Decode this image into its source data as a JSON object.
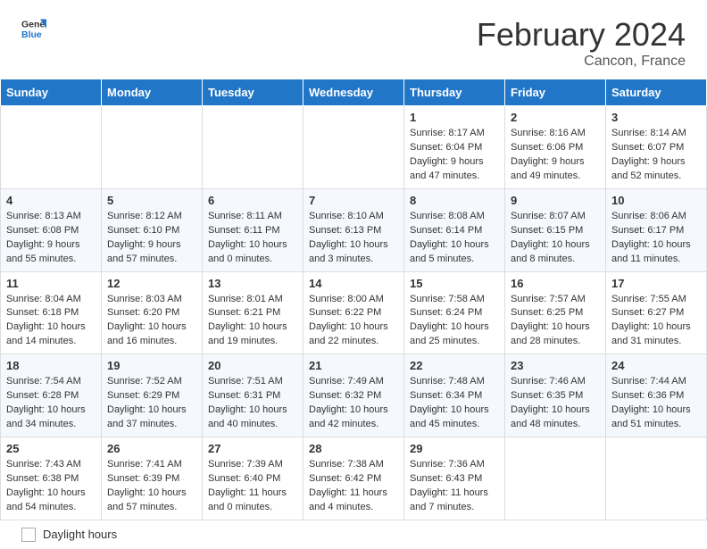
{
  "header": {
    "logo_general": "General",
    "logo_blue": "Blue",
    "month_title": "February 2024",
    "location": "Cancon, France"
  },
  "weekdays": [
    "Sunday",
    "Monday",
    "Tuesday",
    "Wednesday",
    "Thursday",
    "Friday",
    "Saturday"
  ],
  "weeks": [
    [
      {
        "day": "",
        "info": ""
      },
      {
        "day": "",
        "info": ""
      },
      {
        "day": "",
        "info": ""
      },
      {
        "day": "",
        "info": ""
      },
      {
        "day": "1",
        "info": "Sunrise: 8:17 AM\nSunset: 6:04 PM\nDaylight: 9 hours and 47 minutes."
      },
      {
        "day": "2",
        "info": "Sunrise: 8:16 AM\nSunset: 6:06 PM\nDaylight: 9 hours and 49 minutes."
      },
      {
        "day": "3",
        "info": "Sunrise: 8:14 AM\nSunset: 6:07 PM\nDaylight: 9 hours and 52 minutes."
      }
    ],
    [
      {
        "day": "4",
        "info": "Sunrise: 8:13 AM\nSunset: 6:08 PM\nDaylight: 9 hours and 55 minutes."
      },
      {
        "day": "5",
        "info": "Sunrise: 8:12 AM\nSunset: 6:10 PM\nDaylight: 9 hours and 57 minutes."
      },
      {
        "day": "6",
        "info": "Sunrise: 8:11 AM\nSunset: 6:11 PM\nDaylight: 10 hours and 0 minutes."
      },
      {
        "day": "7",
        "info": "Sunrise: 8:10 AM\nSunset: 6:13 PM\nDaylight: 10 hours and 3 minutes."
      },
      {
        "day": "8",
        "info": "Sunrise: 8:08 AM\nSunset: 6:14 PM\nDaylight: 10 hours and 5 minutes."
      },
      {
        "day": "9",
        "info": "Sunrise: 8:07 AM\nSunset: 6:15 PM\nDaylight: 10 hours and 8 minutes."
      },
      {
        "day": "10",
        "info": "Sunrise: 8:06 AM\nSunset: 6:17 PM\nDaylight: 10 hours and 11 minutes."
      }
    ],
    [
      {
        "day": "11",
        "info": "Sunrise: 8:04 AM\nSunset: 6:18 PM\nDaylight: 10 hours and 14 minutes."
      },
      {
        "day": "12",
        "info": "Sunrise: 8:03 AM\nSunset: 6:20 PM\nDaylight: 10 hours and 16 minutes."
      },
      {
        "day": "13",
        "info": "Sunrise: 8:01 AM\nSunset: 6:21 PM\nDaylight: 10 hours and 19 minutes."
      },
      {
        "day": "14",
        "info": "Sunrise: 8:00 AM\nSunset: 6:22 PM\nDaylight: 10 hours and 22 minutes."
      },
      {
        "day": "15",
        "info": "Sunrise: 7:58 AM\nSunset: 6:24 PM\nDaylight: 10 hours and 25 minutes."
      },
      {
        "day": "16",
        "info": "Sunrise: 7:57 AM\nSunset: 6:25 PM\nDaylight: 10 hours and 28 minutes."
      },
      {
        "day": "17",
        "info": "Sunrise: 7:55 AM\nSunset: 6:27 PM\nDaylight: 10 hours and 31 minutes."
      }
    ],
    [
      {
        "day": "18",
        "info": "Sunrise: 7:54 AM\nSunset: 6:28 PM\nDaylight: 10 hours and 34 minutes."
      },
      {
        "day": "19",
        "info": "Sunrise: 7:52 AM\nSunset: 6:29 PM\nDaylight: 10 hours and 37 minutes."
      },
      {
        "day": "20",
        "info": "Sunrise: 7:51 AM\nSunset: 6:31 PM\nDaylight: 10 hours and 40 minutes."
      },
      {
        "day": "21",
        "info": "Sunrise: 7:49 AM\nSunset: 6:32 PM\nDaylight: 10 hours and 42 minutes."
      },
      {
        "day": "22",
        "info": "Sunrise: 7:48 AM\nSunset: 6:34 PM\nDaylight: 10 hours and 45 minutes."
      },
      {
        "day": "23",
        "info": "Sunrise: 7:46 AM\nSunset: 6:35 PM\nDaylight: 10 hours and 48 minutes."
      },
      {
        "day": "24",
        "info": "Sunrise: 7:44 AM\nSunset: 6:36 PM\nDaylight: 10 hours and 51 minutes."
      }
    ],
    [
      {
        "day": "25",
        "info": "Sunrise: 7:43 AM\nSunset: 6:38 PM\nDaylight: 10 hours and 54 minutes."
      },
      {
        "day": "26",
        "info": "Sunrise: 7:41 AM\nSunset: 6:39 PM\nDaylight: 10 hours and 57 minutes."
      },
      {
        "day": "27",
        "info": "Sunrise: 7:39 AM\nSunset: 6:40 PM\nDaylight: 11 hours and 0 minutes."
      },
      {
        "day": "28",
        "info": "Sunrise: 7:38 AM\nSunset: 6:42 PM\nDaylight: 11 hours and 4 minutes."
      },
      {
        "day": "29",
        "info": "Sunrise: 7:36 AM\nSunset: 6:43 PM\nDaylight: 11 hours and 7 minutes."
      },
      {
        "day": "",
        "info": ""
      },
      {
        "day": "",
        "info": ""
      }
    ]
  ],
  "footer": {
    "daylight_label": "Daylight hours"
  }
}
